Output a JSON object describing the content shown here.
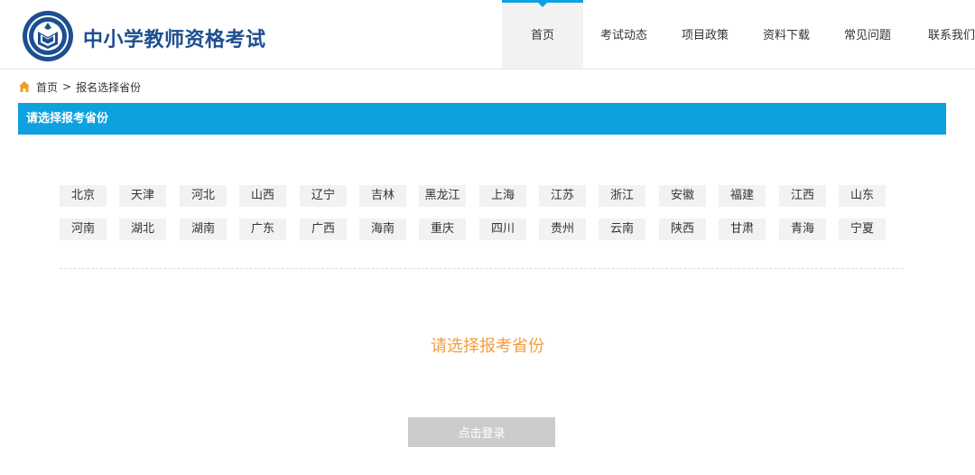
{
  "header": {
    "site_title": "中小学教师资格考试",
    "logo_icon": "exam-seal-logo-icon"
  },
  "nav": {
    "items": [
      {
        "label": "首页",
        "active": true
      },
      {
        "label": "考试动态",
        "active": false
      },
      {
        "label": "项目政策",
        "active": false
      },
      {
        "label": "资料下载",
        "active": false
      },
      {
        "label": "常见问题",
        "active": false
      },
      {
        "label": "联系我们",
        "active": false
      }
    ]
  },
  "breadcrumb": {
    "home_icon": "home-icon",
    "home": "首页",
    "separator": ">",
    "current": "报名选择省份"
  },
  "banner": {
    "title": "请选择报考省份"
  },
  "provinces": {
    "row1": [
      "北京",
      "天津",
      "河北",
      "山西",
      "辽宁",
      "吉林",
      "黑龙江",
      "上海",
      "江苏",
      "浙江",
      "安徽",
      "福建",
      "江西",
      "山东"
    ],
    "row2": [
      "河南",
      "湖北",
      "湖南",
      "广东",
      "广西",
      "海南",
      "重庆",
      "四川",
      "贵州",
      "云南",
      "陕西",
      "甘肃",
      "青海",
      "宁夏"
    ]
  },
  "prompt": "请选择报考省份",
  "login_button": "点击登录",
  "colors": {
    "brand_blue": "#0ea1e0",
    "title_blue": "#1d4f91",
    "prompt_orange": "#f39c3c",
    "disabled_gray": "#cccccc",
    "province_bg": "#f2f2f2"
  }
}
